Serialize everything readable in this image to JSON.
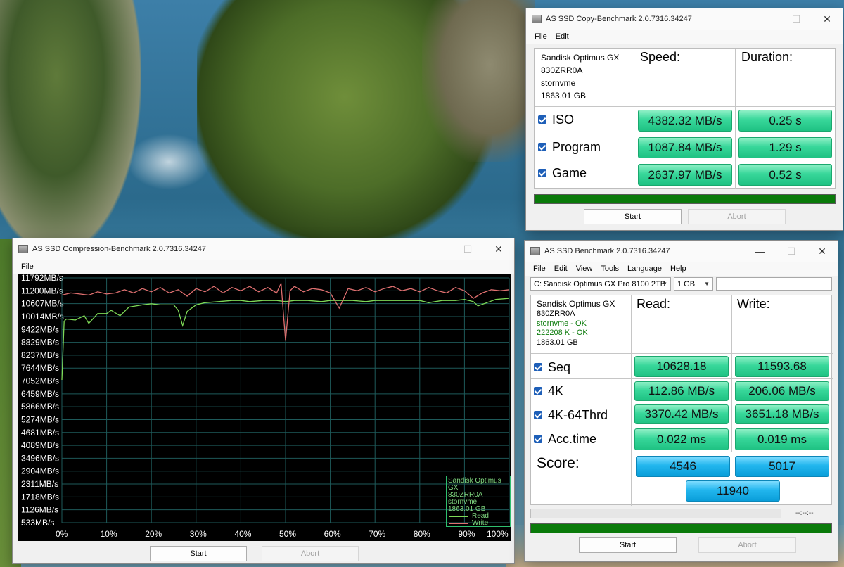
{
  "copy_window": {
    "title": "AS SSD Copy-Benchmark 2.0.7316.34247",
    "menu": [
      "File",
      "Edit"
    ],
    "drive": {
      "model": "Sandisk Optimus GX",
      "serial": "830ZRR0A",
      "driver": "stornvme",
      "size": "1863.01 GB"
    },
    "headers": {
      "speed": "Speed:",
      "duration": "Duration:"
    },
    "rows": [
      {
        "label": "ISO",
        "speed": "4382.32 MB/s",
        "duration": "0.25 s"
      },
      {
        "label": "Program",
        "speed": "1087.84 MB/s",
        "duration": "1.29 s"
      },
      {
        "label": "Game",
        "speed": "2637.97 MB/s",
        "duration": "0.52 s"
      }
    ],
    "progress": 1.0,
    "start_label": "Start",
    "abort_label": "Abort"
  },
  "bench_window": {
    "title": "AS SSD Benchmark 2.0.7316.34247",
    "menu": [
      "File",
      "Edit",
      "View",
      "Tools",
      "Language",
      "Help"
    ],
    "drive_select": "C: Sandisk Optimus GX Pro 8100 2TB",
    "size_select": "1 GB",
    "drive": {
      "model": "Sandisk Optimus GX",
      "serial": "830ZRR0A",
      "driver_ok": "stornvme - OK",
      "align_ok": "222208 K - OK",
      "size": "1863.01 GB"
    },
    "headers": {
      "read": "Read:",
      "write": "Write:"
    },
    "rows": [
      {
        "label": "Seq",
        "read": "10628.18",
        "write": "11593.68"
      },
      {
        "label": "4K",
        "read": "112.86 MB/s",
        "write": "206.06 MB/s"
      },
      {
        "label": "4K-64Thrd",
        "read": "3370.42 MB/s",
        "write": "3651.18 MB/s"
      },
      {
        "label": "Acc.time",
        "read": "0.022 ms",
        "write": "0.019 ms"
      }
    ],
    "score_label": "Score:",
    "score_read": "4546",
    "score_write": "5017",
    "score_total": "11940",
    "time_display": "--:--:--",
    "progress": 1.0,
    "start_label": "Start",
    "abort_label": "Abort"
  },
  "compression_window": {
    "title": "AS SSD Compression-Benchmark 2.0.7316.34247",
    "menu": [
      "File"
    ],
    "start_label": "Start",
    "abort_label": "Abort",
    "legend": {
      "model": "Sandisk Optimus GX",
      "serial": "830ZRR0A",
      "driver": "stornvme",
      "size": "1863.01 GB"
    }
  },
  "chart_data": {
    "type": "line",
    "y_tick_labels": [
      "11792MB/s",
      "11200MB/s",
      "10607MB/s",
      "10014MB/s",
      "9422MB/s",
      "8829MB/s",
      "8237MB/s",
      "7644MB/s",
      "7052MB/s",
      "6459MB/s",
      "5866MB/s",
      "5274MB/s",
      "4681MB/s",
      "4089MB/s",
      "3496MB/s",
      "2904MB/s",
      "2311MB/s",
      "1718MB/s",
      "1126MB/s",
      "533MB/s"
    ],
    "x_tick_labels": [
      "0%",
      "10%",
      "20%",
      "30%",
      "40%",
      "50%",
      "60%",
      "70%",
      "80%",
      "90%",
      "100%"
    ],
    "ylim": [
      533,
      11792
    ],
    "xlim": [
      0,
      100
    ],
    "grid": true,
    "legend_position": "bottom-right",
    "series": [
      {
        "name": "Read",
        "color": "#7ed957",
        "x": [
          0,
          0.5,
          1,
          3,
          5,
          6,
          8,
          10,
          11,
          13,
          15,
          18,
          20,
          22,
          25,
          26,
          27,
          28,
          30,
          32,
          35,
          38,
          40,
          42,
          45,
          48,
          50,
          52,
          55,
          58,
          60,
          62,
          65,
          68,
          70,
          72,
          75,
          78,
          80,
          82,
          85,
          88,
          90,
          92,
          93,
          95,
          97,
          100
        ],
        "y": [
          7100,
          9800,
          9900,
          9850,
          10050,
          9700,
          10150,
          10150,
          10300,
          10050,
          10450,
          10550,
          10600,
          10550,
          10550,
          10300,
          9600,
          10250,
          10550,
          10650,
          10700,
          10750,
          10750,
          10700,
          10750,
          10750,
          10700,
          10750,
          10750,
          10700,
          10750,
          10750,
          10750,
          10700,
          10750,
          10750,
          10750,
          10750,
          10750,
          10650,
          10750,
          10750,
          10800,
          10700,
          10500,
          10650,
          10800,
          10850
        ]
      },
      {
        "name": "Write",
        "color": "#e07070",
        "x": [
          0,
          2,
          4,
          6,
          8,
          10,
          12,
          14,
          16,
          18,
          20,
          22,
          24,
          26,
          28,
          30,
          32,
          34,
          36,
          38,
          40,
          42,
          44,
          46,
          48,
          49,
          50,
          51,
          52,
          54,
          56,
          58,
          60,
          62,
          64,
          66,
          68,
          70,
          72,
          74,
          76,
          78,
          80,
          82,
          84,
          86,
          88,
          90,
          92,
          94,
          96,
          98,
          100
        ],
        "y": [
          11000,
          11100,
          11050,
          11000,
          11150,
          11050,
          11100,
          11250,
          11100,
          11300,
          11150,
          11350,
          11100,
          11250,
          10950,
          11300,
          11150,
          11400,
          11100,
          11350,
          11200,
          11400,
          11150,
          11350,
          11100,
          11550,
          8900,
          11200,
          11400,
          11150,
          11300,
          11250,
          11100,
          10400,
          11300,
          11200,
          11350,
          11150,
          11300,
          11400,
          11200,
          11300,
          11150,
          11350,
          11200,
          11100,
          11350,
          11200,
          10850,
          11100,
          11250,
          11200,
          11250
        ]
      }
    ]
  }
}
